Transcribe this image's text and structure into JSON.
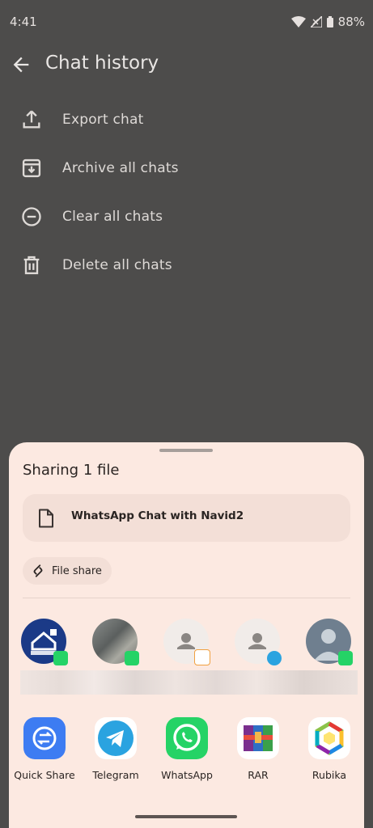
{
  "status_bar": {
    "time": "4:41",
    "battery": "88%"
  },
  "app_bar": {
    "title": "Chat history"
  },
  "menu": [
    {
      "label": "Export chat",
      "icon": "upload-icon"
    },
    {
      "label": "Archive all chats",
      "icon": "archive-icon"
    },
    {
      "label": "Clear all chats",
      "icon": "minus-circle-icon"
    },
    {
      "label": "Delete all chats",
      "icon": "trash-icon"
    }
  ],
  "share_sheet": {
    "title": "Sharing 1 file",
    "file_name": "WhatsApp Chat with Navid2",
    "chip_label": "File share",
    "contacts": [
      {
        "badge": "whatsapp"
      },
      {
        "badge": "whatsapp"
      },
      {
        "badge": "other-app"
      },
      {
        "badge": "telegram"
      },
      {
        "badge": "whatsapp"
      }
    ],
    "apps": [
      {
        "label": "Quick Share",
        "icon": "quick-share-icon"
      },
      {
        "label": "Telegram",
        "icon": "telegram-icon"
      },
      {
        "label": "WhatsApp",
        "icon": "whatsapp-icon"
      },
      {
        "label": "RAR",
        "icon": "rar-icon"
      },
      {
        "label": "Rubika",
        "icon": "rubika-icon"
      }
    ]
  },
  "colors": {
    "scrim_background": "#4d4c4b",
    "sheet_background": "#fce9e1",
    "whatsapp_green": "#25d366",
    "telegram_blue": "#2aa3e0",
    "quick_share_blue": "#3d7cf2"
  }
}
